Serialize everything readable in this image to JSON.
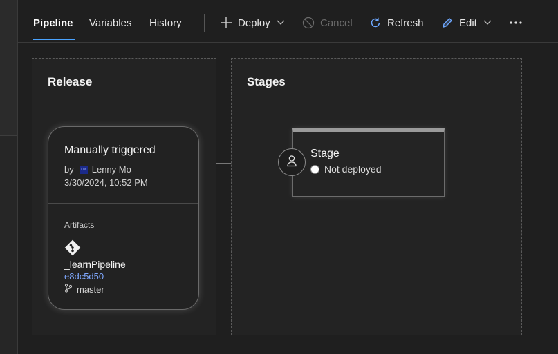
{
  "toolbar": {
    "tabs": [
      {
        "label": "Pipeline",
        "active": true
      },
      {
        "label": "Variables",
        "active": false
      },
      {
        "label": "History",
        "active": false
      }
    ],
    "deploy_label": "Deploy",
    "cancel_label": "Cancel",
    "refresh_label": "Refresh",
    "edit_label": "Edit",
    "more_icon": "more-horizontal-icon"
  },
  "colors": {
    "accent": "#4aa3ff",
    "link": "#7fa8ff",
    "background": "#1f1f1f"
  },
  "release": {
    "title": "Release",
    "trigger": "Manually triggered",
    "by_label": "by",
    "avatar_initials": "LM",
    "user": "Lenny Mo",
    "timestamp": "3/30/2024, 10:52 PM",
    "artifacts_label": "Artifacts",
    "artifact": {
      "name": "_learnPipeline",
      "commit": "e8dc5d50",
      "branch": "master"
    }
  },
  "stages": {
    "title": "Stages",
    "items": [
      {
        "name": "Stage",
        "status": "Not deployed"
      }
    ]
  }
}
